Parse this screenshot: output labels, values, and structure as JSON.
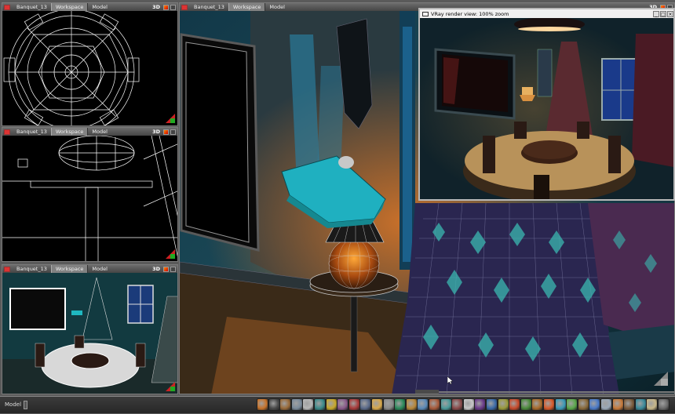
{
  "viewports": {
    "top": {
      "file": "Banquet_13",
      "tab_workspace": "Workspace",
      "tab_model": "Model",
      "mode": "3D"
    },
    "front": {
      "file": "Banquet_13",
      "tab_workspace": "Workspace",
      "tab_model": "Model",
      "mode": "3D"
    },
    "persp": {
      "file": "Banquet_13",
      "tab_workspace": "Workspace",
      "tab_model": "Model",
      "mode": "3D"
    },
    "main": {
      "file": "Banquet_13",
      "tab_workspace": "Workspace",
      "tab_model": "Model",
      "mode": "3D"
    }
  },
  "vray": {
    "title": "VRay render view: 100% zoom"
  },
  "status": {
    "label": "Model"
  },
  "toolbar_icons": [
    {
      "name": "select-tool-icon",
      "color": "#c8732a"
    },
    {
      "name": "sphere-tool-icon",
      "color": "#4a4a4a"
    },
    {
      "name": "cube-tool-icon",
      "color": "#9a6b3a"
    },
    {
      "name": "wire-box-tool-icon",
      "color": "#7a8a9a"
    },
    {
      "name": "box-tool-icon",
      "color": "#b8b8b8"
    },
    {
      "name": "cylinder-tool-icon",
      "color": "#3a8a8a"
    },
    {
      "name": "disc-tool-icon",
      "color": "#c8a82a"
    },
    {
      "name": "lathe-tool-icon",
      "color": "#8a5a8a"
    },
    {
      "name": "link-tool-icon",
      "color": "#a83a3a"
    },
    {
      "name": "camera-tool-icon",
      "color": "#5a6a8a"
    },
    {
      "name": "light-tool-icon",
      "color": "#d8a84a"
    },
    {
      "name": "grid-tool-icon",
      "color": "#8a8a8a"
    },
    {
      "name": "mesh-tool-icon",
      "color": "#2a8a5a"
    },
    {
      "name": "shell-tool-icon",
      "color": "#b8883a"
    },
    {
      "name": "bend-tool-icon",
      "color": "#5a8ab8"
    },
    {
      "name": "twist-tool-icon",
      "color": "#a85a3a"
    },
    {
      "name": "taper-tool-icon",
      "color": "#4a9a9a"
    },
    {
      "name": "wave-tool-icon",
      "color": "#8a4a4a"
    },
    {
      "name": "text-tool-icon",
      "color": "#c8c8c8"
    },
    {
      "name": "boolean-tool-icon",
      "color": "#6a3a8a"
    },
    {
      "name": "array-tool-icon",
      "color": "#3a6aa8"
    },
    {
      "name": "mirror-tool-icon",
      "color": "#9a9a3a"
    },
    {
      "name": "align-tool-icon",
      "color": "#c84a2a"
    },
    {
      "name": "group-tool-icon",
      "color": "#4a8a3a"
    },
    {
      "name": "material-tool-icon",
      "color": "#a86a2a"
    },
    {
      "name": "render-tool-icon",
      "color": "#d85a2a"
    },
    {
      "name": "paint-tool-icon",
      "color": "#3a9ab8"
    },
    {
      "name": "tree-tool-icon",
      "color": "#5aa84a"
    },
    {
      "name": "terrain-tool-icon",
      "color": "#8a6a3a"
    },
    {
      "name": "sky-tool-icon",
      "color": "#4a7ac8"
    },
    {
      "name": "fog-tool-icon",
      "color": "#9aa8b8"
    },
    {
      "name": "particle-tool-icon",
      "color": "#c87a3a"
    },
    {
      "name": "hair-tool-icon",
      "color": "#7a5a3a"
    },
    {
      "name": "cloth-tool-icon",
      "color": "#3a8a9a"
    },
    {
      "name": "bones-tool-icon",
      "color": "#c8b88a"
    },
    {
      "name": "scene-tool-icon",
      "color": "#6a6a6a"
    }
  ]
}
